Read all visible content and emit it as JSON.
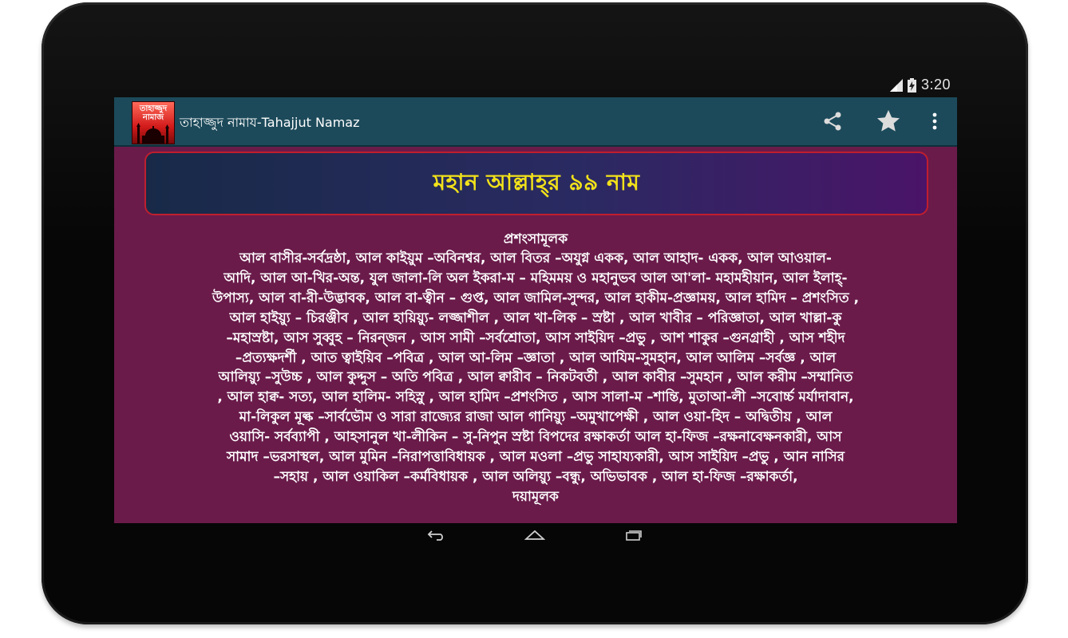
{
  "status_bar": {
    "time": "3:20",
    "icons": [
      "signal-icon",
      "battery-charging-icon"
    ]
  },
  "action_bar": {
    "app_icon_text": [
      "তাহাজ্জুদ",
      "নামাজ"
    ],
    "title": "তাহাজ্জুদ নামায-Tahajjut Namaz",
    "icons": [
      "share-icon",
      "star-icon",
      "overflow-menu-icon"
    ]
  },
  "banner": {
    "title": "মহান আল্লাহ্‌র ৯৯ নাম"
  },
  "content": {
    "heading_top": "প্রশংসামূলক",
    "lines": [
      "আল বাসীর-সর্বদ্রষ্ঠা, আল কাইয়ুম –অবিনশ্বর, আল বিতর –অযুগ্ন একক, আল আহাদ- একক, আল আওয়াল-",
      "আদি, আল আ-খির-অন্ত, যুল জালা-লি অল ইকরা-ম – মহিমময় ও মহানুভব আল আ'লা- মহামহীয়ান, আল ইলাহ্‌-",
      "উপাস্য, আল বা-রী-উদ্ভাবক, আল বা-ত্বীন – গুপ্ত, আল জামিল-সুন্দর, আল হাকীম-প্রজ্ঞাময়, আল হামিদ – প্রশংসিত ,",
      "আল হাইয়্যু – চিরঞ্জীব , আল হায়িয়্যু- লজ্জাশীল , আল খা-লিক – স্রষ্টা , আল খাবীর – পরিজ্ঞাতা, আল খাল্লা-কু",
      "–মহাস্রষ্টা, আস সুব্বুহ – নিরন্জন , আস সামী –সর্বশ্রোতা, আস সাইয়িদ –প্রভু , আশ শাকুর –গুনগ্রাহী , আস শহীদ",
      "–প্রত্যক্ষদর্শী , আত ত্বাইয়িব –পবিত্র , আল আ-লিম –জ্ঞাতা , আল আযিম-সুমহান, আল আলিম –সর্বজ্ঞ , আল",
      "আলিয়্যু –সুউচ্চ , আল কুদ্দুস – অতি পবিত্র , আল ক্বারীব – নিকটবর্তী , আল কাবীর –সুমহান , আল করীম –সম্মানিত",
      ", আল হাক্ব- সত্য, আল হালিম- সহিস্নু , আল হামিদ –প্রশংসিত , আস সালা-ম –শান্তি, মুতাআ-লী –সবোর্চ্চ মর্যাদাবান,",
      "মা-লিকুল মূল্ক –সার্বভৌম ও সারা রাজ্যের রাজা আল গানিয়্যু –অমুখাপেক্ষী , আল ওয়া-হিদ – অদ্বিতীয় , আল",
      "ওয়াসি- সর্বব্যাপী , আহসানুল খা-লীকিন – সু-নিপুন স্রষ্টা বিপদের রক্ষাকর্তা আল হা-ফিজ –রক্ষনাবেক্ষনকারী, আস",
      "সামাদ –ভরসাস্থল, আল মুমিন –নিরাপত্তাবিধায়ক , আল মওলা –প্রভু সাহায্যকারী, আস সাইয়িদ –প্রভু , আন নাসির",
      "–সহায় , আল ওয়াকিল –কর্মবিধায়ক , আল অলিয়্যু –বন্ধু, অভিভাবক , আল হা-ফিজ –রক্ষাকর্তা,"
    ],
    "heading_bottom": "দয়ামূলক"
  },
  "nav_bar": {
    "icons": [
      "back-icon",
      "home-icon",
      "recent-apps-icon"
    ]
  },
  "colors": {
    "action_bar": "#1c4a5a",
    "content_bg": "#6a1b4a",
    "banner_border": "#c01e2e",
    "banner_text": "#f2e21a"
  }
}
